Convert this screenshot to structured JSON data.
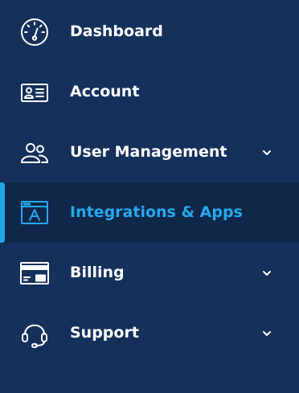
{
  "colors": {
    "background": "#15305b",
    "active_background": "#0f2748",
    "accent": "#22a7ef",
    "text": "#ffffff",
    "active_text": "#27a9ee"
  },
  "sidebar": {
    "items": [
      {
        "label": "Dashboard",
        "icon": "speedometer-icon",
        "has_submenu": false,
        "active": false
      },
      {
        "label": "Account",
        "icon": "id-card-icon",
        "has_submenu": false,
        "active": false
      },
      {
        "label": "User Management",
        "icon": "users-icon",
        "has_submenu": true,
        "active": false
      },
      {
        "label": "Integrations & Apps",
        "icon": "app-window-icon",
        "has_submenu": false,
        "active": true
      },
      {
        "label": "Billing",
        "icon": "credit-card-icon",
        "has_submenu": true,
        "active": false
      },
      {
        "label": "Support",
        "icon": "headset-icon",
        "has_submenu": true,
        "active": false
      }
    ]
  }
}
